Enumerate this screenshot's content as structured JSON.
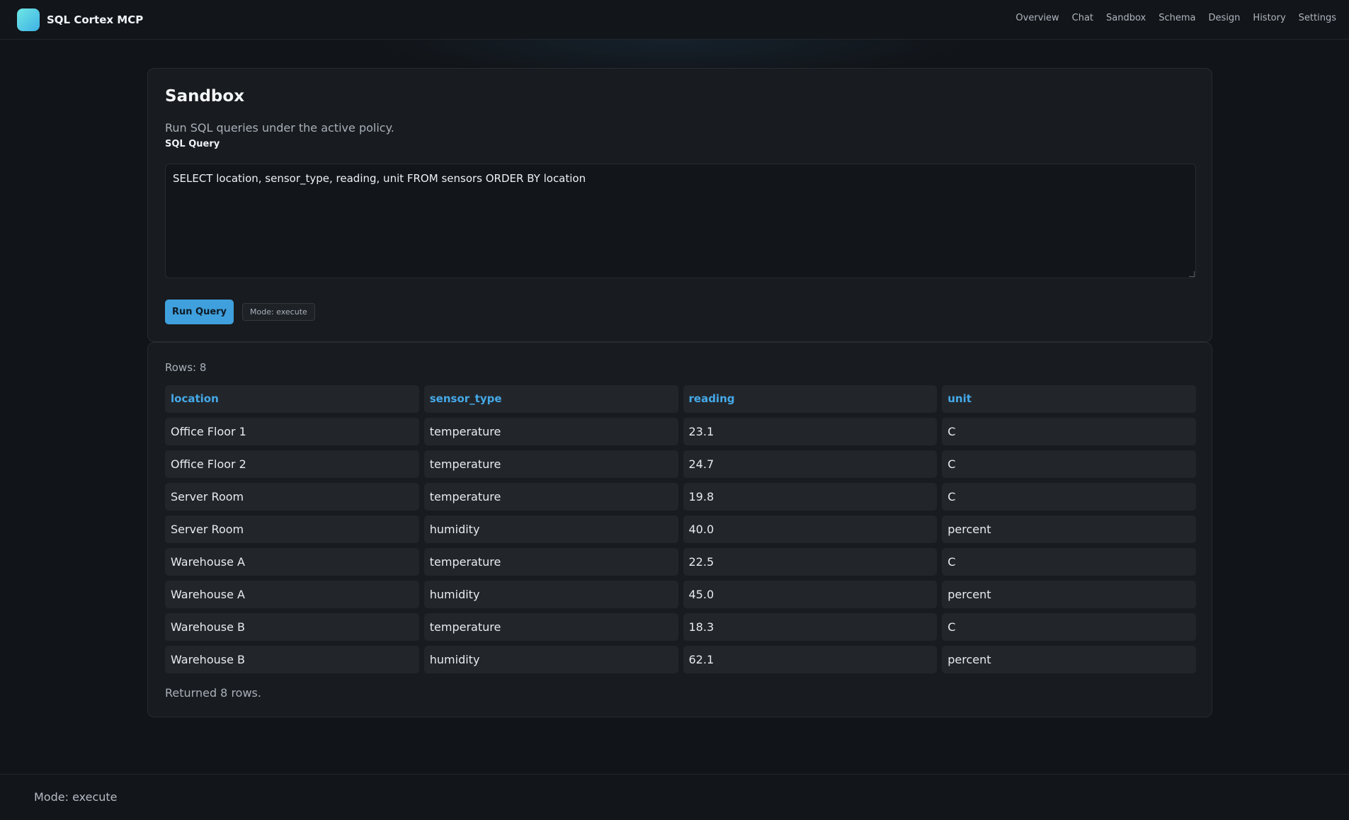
{
  "app": {
    "name": "SQL Cortex MCP"
  },
  "nav": {
    "items": [
      "Overview",
      "Chat",
      "Sandbox",
      "Schema",
      "Design",
      "History",
      "Settings"
    ]
  },
  "sandbox": {
    "title": "Sandbox",
    "subtitle": "Run SQL queries under the active policy.",
    "query_label": "SQL Query",
    "query_value": "SELECT location, sensor_type, reading, unit FROM sensors ORDER BY location",
    "run_label": "Run Query",
    "mode_chip": "Mode: execute"
  },
  "results": {
    "rows_label": "Rows: 8",
    "columns": [
      "location",
      "sensor_type",
      "reading",
      "unit"
    ],
    "rows": [
      [
        "Office Floor 1",
        "temperature",
        "23.1",
        "C"
      ],
      [
        "Office Floor 2",
        "temperature",
        "24.7",
        "C"
      ],
      [
        "Server Room",
        "temperature",
        "19.8",
        "C"
      ],
      [
        "Server Room",
        "humidity",
        "40.0",
        "percent"
      ],
      [
        "Warehouse A",
        "temperature",
        "22.5",
        "C"
      ],
      [
        "Warehouse A",
        "humidity",
        "45.0",
        "percent"
      ],
      [
        "Warehouse B",
        "temperature",
        "18.3",
        "C"
      ],
      [
        "Warehouse B",
        "humidity",
        "62.1",
        "percent"
      ]
    ],
    "returned_label": "Returned 8 rows."
  },
  "footer": {
    "mode": "Mode: execute"
  },
  "colors": {
    "accent": "#3fa0dd",
    "header_text": "#45a9e8",
    "background": "#111418",
    "card": "#181b1f"
  }
}
